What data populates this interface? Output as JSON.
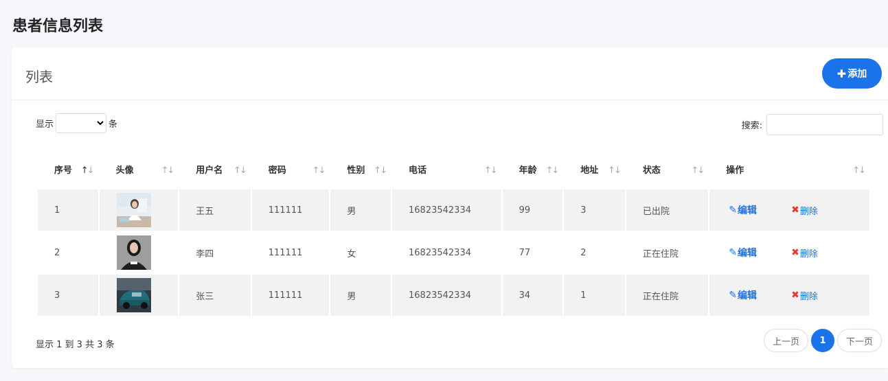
{
  "page_title": "患者信息列表",
  "card": {
    "title": "列表",
    "add_label": "添加",
    "length_prefix": "显示",
    "length_suffix": "条",
    "search_label": "搜索:",
    "search_value": ""
  },
  "table": {
    "headers": [
      "序号",
      "头像",
      "用户名",
      "密码",
      "性别",
      "电话",
      "年龄",
      "地址",
      "状态",
      "操作"
    ],
    "rows": [
      {
        "index": "1",
        "username": "王五",
        "password": "111111",
        "gender": "男",
        "phone": "16823542334",
        "age": "99",
        "address": "3",
        "status": "已出院"
      },
      {
        "index": "2",
        "username": "李四",
        "password": "111111",
        "gender": "女",
        "phone": "16823542334",
        "age": "77",
        "address": "2",
        "status": "正在住院"
      },
      {
        "index": "3",
        "username": "张三",
        "password": "111111",
        "gender": "男",
        "phone": "16823542334",
        "age": "34",
        "address": "1",
        "status": "正在住院"
      }
    ],
    "edit_label": "编辑",
    "delete_label": "删除"
  },
  "footer": {
    "info": "显示 1 到 3 共 3 条",
    "prev_label": "上一页",
    "current_page": "1",
    "next_label": "下一页"
  },
  "colors": {
    "accent": "#1a73e8",
    "delete_x": "#e53935",
    "row_stripe": "#f2f2f2"
  }
}
